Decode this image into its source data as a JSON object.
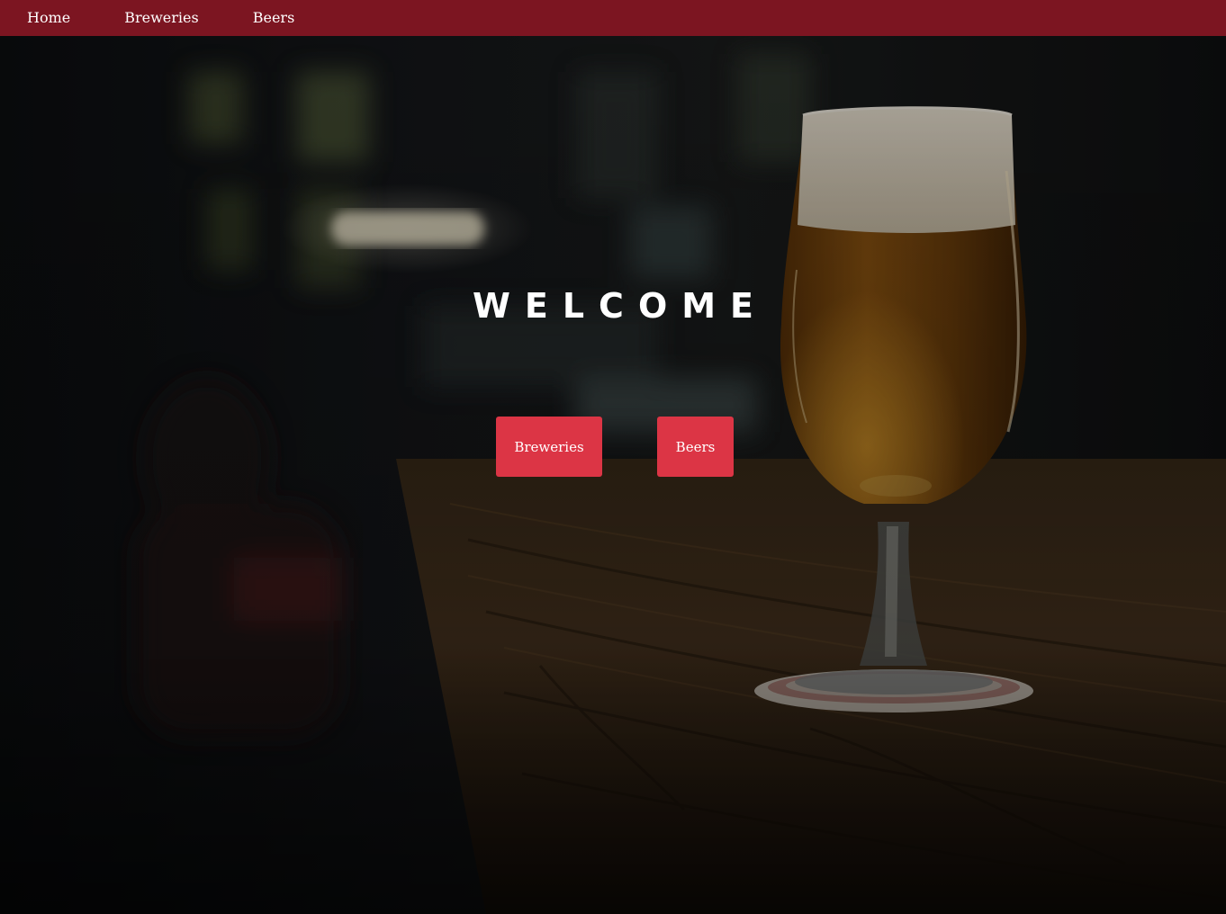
{
  "nav": {
    "items": [
      {
        "label": "Home"
      },
      {
        "label": "Breweries"
      },
      {
        "label": "Beers"
      }
    ],
    "background": "#7c1521"
  },
  "hero": {
    "heading": "WELCOME",
    "background_description_icon": "beer-glass-on-bar-photo",
    "buttons": [
      {
        "label": "Breweries"
      },
      {
        "label": "Beers"
      }
    ],
    "button_color": "#dc3545"
  }
}
